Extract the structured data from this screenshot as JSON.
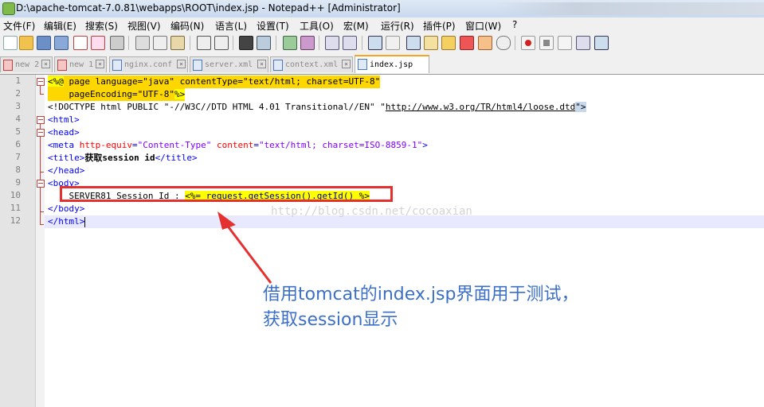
{
  "window": {
    "title": "D:\\apache-tomcat-7.0.81\\webapps\\ROOT\\index.jsp - Notepad++ [Administrator]"
  },
  "menu": {
    "items": [
      "文件(F)",
      "编辑(E)",
      "搜索(S)",
      "视图(V)",
      "编码(N)",
      "语言(L)",
      "设置(T)",
      "工具(O)",
      "宏(M)",
      "运行(R)",
      "插件(P)",
      "窗口(W)",
      "?"
    ]
  },
  "toolbar": {
    "icons": [
      "new-file-icon",
      "open-file-icon",
      "save-icon",
      "save-all-icon",
      "close-icon",
      "close-all-icon",
      "print-icon",
      "cut-icon",
      "copy-icon",
      "paste-icon",
      "undo-icon",
      "redo-icon",
      "find-icon",
      "replace-icon",
      "zoom-in-icon",
      "zoom-out-icon",
      "sync-vertical-icon",
      "sync-horizontal-icon",
      "word-wrap-icon",
      "show-all-chars-icon",
      "indent-guide-icon",
      "user-language-icon",
      "doc-map-icon",
      "function-list-icon",
      "folder-workspace-icon",
      "monitoring-icon",
      "record-macro-icon",
      "stop-macro-icon",
      "play-macro-icon",
      "run-macro-multiple-icon",
      "save-macro-icon"
    ]
  },
  "tabs": [
    {
      "label": "new 2",
      "state": "modified"
    },
    {
      "label": "new 1",
      "state": "modified"
    },
    {
      "label": "nginx.conf",
      "state": "saved"
    },
    {
      "label": "server.xml",
      "state": "saved"
    },
    {
      "label": "context.xml",
      "state": "saved"
    },
    {
      "label": "index.jsp",
      "state": "active"
    }
  ],
  "editor": {
    "line_numbers": [
      "1",
      "2",
      "3",
      "4",
      "5",
      "6",
      "7",
      "8",
      "9",
      "10",
      "11",
      "12"
    ],
    "lines": {
      "l1_open": "<%@",
      "l1_rest": " page language=\"java\" contentType=\"text/html; charset=UTF-8\"",
      "l2_text": "    pageEncoding=\"UTF-8\"",
      "l2_close": "%>",
      "l3_text": "<!DOCTYPE html PUBLIC \"-//W3C//DTD HTML 4.01 Transitional//EN\" \"",
      "l3_url": "http://www.w3.org/TR/html4/loose.dtd",
      "l3_end": "\">",
      "l4": "<html>",
      "l5": "<head>",
      "l6_tag": "<meta ",
      "l6_attr1": "http-equiv",
      "l6_eq1": "=",
      "l6_val1": "\"Content-Type\"",
      "l6_attr2": " content",
      "l6_eq2": "=",
      "l6_val2": "\"text/html; charset=ISO-8859-1\"",
      "l6_close": ">",
      "l7_open": "<title>",
      "l7_text": "获取session id",
      "l7_close": "</title>",
      "l8": "</head>",
      "l9": "<body>",
      "l10_text": "    SERVER81 Session Id : ",
      "l10_jsp_open": "<%=",
      "l10_expr": " request.getSession().getId() ",
      "l10_jsp_close": "%>",
      "l11": "</body>",
      "l12": "</html>"
    },
    "watermark": "http://blog.csdn.net/cocoaxian"
  },
  "annotation": {
    "line1": "借用tomcat的index.jsp界面用于测试，",
    "line2": "获取session显示",
    "color": "#3b6fc8",
    "box_color": "#e53030"
  }
}
